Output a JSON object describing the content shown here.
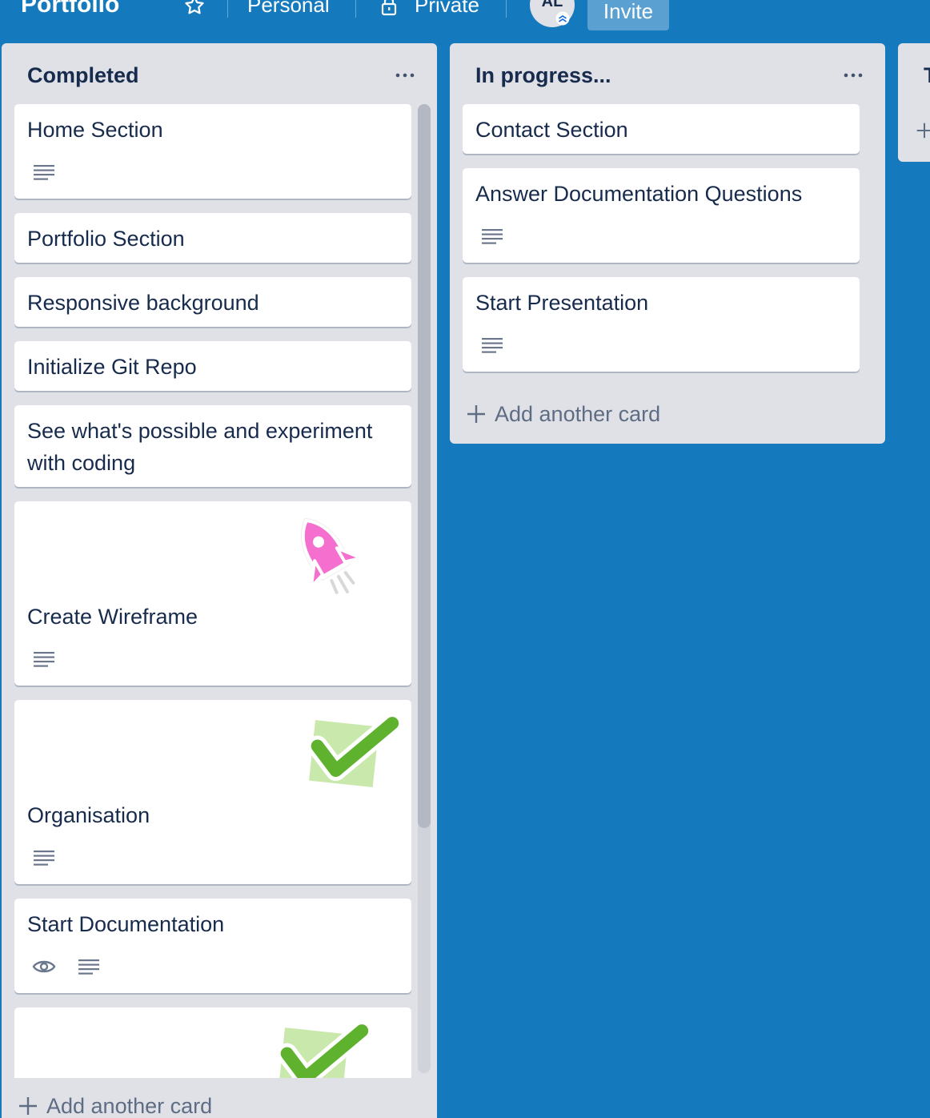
{
  "header": {
    "board_title": "Portfolio",
    "team_label": "Personal",
    "visibility_label": "Private",
    "avatar_initials": "AL",
    "invite_label": "Invite"
  },
  "lists": {
    "completed": {
      "title": "Completed",
      "cards": [
        "Home Section",
        "Portfolio Section",
        "Responsive background",
        "Initialize Git Repo",
        "See what's possible and experiment with coding",
        "Create Wireframe",
        "Organisation",
        "Start Documentation"
      ],
      "add_label": "Add another card"
    },
    "in_progress": {
      "title": "In progress...",
      "cards": [
        "Contact Section",
        "Answer Documentation Questions",
        "Start Presentation"
      ],
      "add_label": "Add another card"
    },
    "next": {
      "title": "T"
    }
  },
  "icons": {
    "star": "star-icon",
    "lock": "lock-icon",
    "menu": "more-horizontal-icon",
    "description": "description-icon",
    "watch": "eye-icon",
    "add": "plus-icon",
    "stickers": [
      "rocket-sticker",
      "check-sticker"
    ]
  },
  "colors": {
    "board_background": "#1479bd",
    "list_background": "#dfe1e6",
    "card_background": "#ffffff",
    "text": "#172b4d",
    "muted_text": "#5e6c84",
    "rocket": "#f56fcf",
    "check_green": "#61bd4f"
  }
}
